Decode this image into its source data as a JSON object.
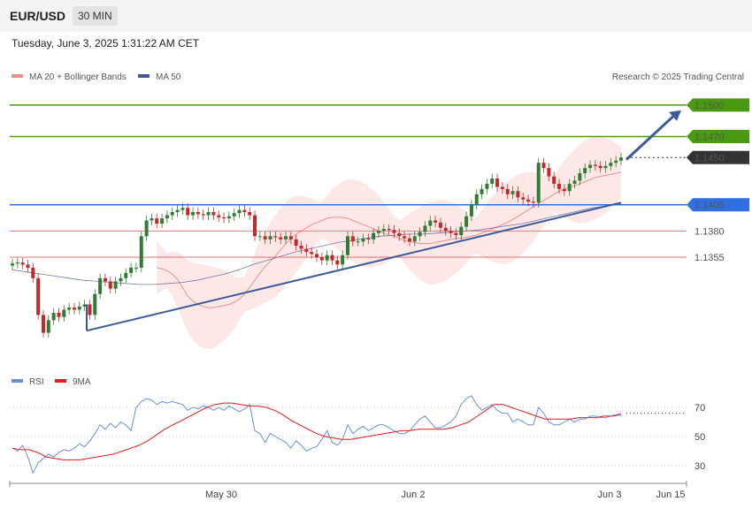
{
  "header": {
    "symbol": "EUR/USD",
    "interval": "30 MIN",
    "datetime": "Tuesday, June 3, 2025 1:31:22 AM CET"
  },
  "copyright": "Research © 2025 Trading Central",
  "colors": {
    "up": "#2e7d32",
    "down": "#c62828",
    "bb_fill": "#fde3e3",
    "ma20": "#ef8f8f",
    "ma50": "#4a5f9a",
    "trend": "#3a5a9a",
    "rsi": "#6a8fd8",
    "rsi_ma": "#e21b1b"
  },
  "chart_data": [
    {
      "type": "candlestick",
      "legend": [
        {
          "label": "MA 20 + Bollinger Bands",
          "color": "#f28b82"
        },
        {
          "label": "MA 50",
          "color": "#3a5a9a"
        }
      ],
      "x_ticks": [
        "May 30",
        "Jun 2",
        "Jun 3",
        "Jun 15"
      ],
      "y_range": [
        1.127,
        1.151
      ],
      "levels": [
        {
          "value": 1.15,
          "label": "1.1500",
          "color": "#4a9a0f",
          "style": "solid",
          "tag": true
        },
        {
          "value": 1.147,
          "label": "1.1470",
          "color": "#4a9a0f",
          "style": "solid",
          "tag": true
        },
        {
          "value": 1.145,
          "label": "1.1450",
          "color": "#333333",
          "style": "dotted",
          "tag": true
        },
        {
          "value": 1.1405,
          "label": "1.1405",
          "color": "#2f6fe0",
          "style": "solid",
          "tag": true
        },
        {
          "value": 1.138,
          "label": "1.1380",
          "color": "#e06060",
          "style": "solid",
          "tag": false
        },
        {
          "value": 1.1355,
          "label": "1.1355",
          "color": "#e06060",
          "style": "solid",
          "tag": false
        }
      ],
      "closes": [
        1.1349,
        1.135,
        1.1348,
        1.1345,
        1.1335,
        1.13,
        1.1283,
        1.1295,
        1.1302,
        1.1298,
        1.1305,
        1.1307,
        1.1305,
        1.1308,
        1.131,
        1.13,
        1.132,
        1.1335,
        1.1332,
        1.1325,
        1.1332,
        1.1335,
        1.134,
        1.1345,
        1.1345,
        1.1375,
        1.139,
        1.1392,
        1.1387,
        1.1392,
        1.1395,
        1.1398,
        1.14,
        1.1402,
        1.1395,
        1.1398,
        1.1396,
        1.1395,
        1.1398,
        1.1395,
        1.1393,
        1.1392,
        1.1394,
        1.1397,
        1.14,
        1.1398,
        1.1395,
        1.1375,
        1.1375,
        1.1372,
        1.1375,
        1.1374,
        1.1372,
        1.1375,
        1.1372,
        1.1366,
        1.1363,
        1.136,
        1.1358,
        1.1355,
        1.1352,
        1.1357,
        1.1352,
        1.1348,
        1.1357,
        1.1375,
        1.137,
        1.137,
        1.1373,
        1.1372,
        1.1378,
        1.138,
        1.1382,
        1.1381,
        1.1378,
        1.1375,
        1.1373,
        1.137,
        1.1375,
        1.1379,
        1.1385,
        1.139,
        1.1388,
        1.1383,
        1.138,
        1.1378,
        1.1376,
        1.1384,
        1.1394,
        1.1405,
        1.1415,
        1.142,
        1.1425,
        1.143,
        1.1422,
        1.142,
        1.1415,
        1.1418,
        1.1412,
        1.141,
        1.1408,
        1.1407,
        1.1445,
        1.144,
        1.1432,
        1.1425,
        1.142,
        1.1418,
        1.1425,
        1.1428,
        1.1435,
        1.144,
        1.1443,
        1.1442,
        1.144,
        1.1442,
        1.1445,
        1.1447,
        1.145
      ],
      "ma20": [
        1.1345,
        1.1344,
        1.1342,
        1.1339,
        1.1334,
        1.1326,
        1.1318,
        1.1313,
        1.131,
        1.1308,
        1.1307,
        1.1307,
        1.1308,
        1.1309,
        1.131,
        1.1312,
        1.1315,
        1.132,
        1.1326,
        1.1333,
        1.134,
        1.1346,
        1.1351,
        1.1356,
        1.1362,
        1.1368,
        1.1373,
        1.1377,
        1.138,
        1.1383,
        1.1386,
        1.1388,
        1.139,
        1.1392,
        1.1393,
        1.1393,
        1.1393,
        1.1392,
        1.139,
        1.1388,
        1.1386,
        1.1384,
        1.1382,
        1.138,
        1.1378,
        1.1376,
        1.1375,
        1.1373,
        1.1371,
        1.137,
        1.1369,
        1.1368,
        1.1368,
        1.1368,
        1.1369,
        1.137,
        1.1371,
        1.1372,
        1.1373,
        1.1373,
        1.1374,
        1.1375,
        1.1376,
        1.1378,
        1.138,
        1.1382,
        1.1384,
        1.1386,
        1.1388,
        1.1391,
        1.1394,
        1.1397,
        1.14,
        1.1403,
        1.1406,
        1.1409,
        1.1412,
        1.1415,
        1.1418,
        1.142,
        1.1422,
        1.1423,
        1.1425,
        1.1427,
        1.1429,
        1.1431,
        1.1432,
        1.1433,
        1.1434,
        1.1435,
        1.1436
      ],
      "ma50": [
        1.1343,
        1.1341,
        1.1339,
        1.1337,
        1.1335,
        1.1333,
        1.1332,
        1.1331,
        1.133,
        1.1329,
        1.1329,
        1.133,
        1.1331,
        1.1333,
        1.1336,
        1.1339,
        1.1343,
        1.1348,
        1.1352,
        1.1356,
        1.136,
        1.1363,
        1.1366,
        1.1369,
        1.1371,
        1.1373,
        1.1375,
        1.1376,
        1.1377,
        1.1377,
        1.1378,
        1.1379,
        1.138,
        1.1381,
        1.1383,
        1.1385,
        1.1387,
        1.139,
        1.1393,
        1.1396,
        1.1399,
        1.1402,
        1.1404,
        1.1406
      ],
      "trendlines": [
        {
          "x": [
            "May 29",
            "Jun 3"
          ],
          "y": [
            1.1285,
            1.1407
          ]
        },
        {
          "x": [
            "May 29",
            "Jun 3"
          ],
          "y": [
            1.1285,
            1.13
          ]
        }
      ],
      "arrow": {
        "from": 1.1448,
        "to": 1.1495
      }
    },
    {
      "type": "line",
      "legend": [
        {
          "label": "RSI",
          "color": "#6a8fd8"
        },
        {
          "label": "9MA",
          "color": "#e21b1b"
        }
      ],
      "y_ticks": [
        70,
        50,
        30
      ],
      "rsi": [
        42,
        40,
        44,
        36,
        25,
        32,
        35,
        38,
        36,
        39,
        41,
        40,
        42,
        45,
        43,
        47,
        52,
        58,
        55,
        59,
        56,
        60,
        58,
        54,
        70,
        74,
        76,
        75,
        72,
        74,
        73,
        74,
        73,
        72,
        68,
        70,
        69,
        71,
        70,
        68,
        70,
        68,
        71,
        69,
        67,
        69,
        72,
        54,
        52,
        46,
        52,
        50,
        48,
        46,
        42,
        47,
        44,
        40,
        42,
        43,
        48,
        54,
        46,
        44,
        48,
        58,
        52,
        55,
        57,
        54,
        56,
        58,
        58,
        56,
        54,
        52,
        52,
        54,
        58,
        62,
        64,
        60,
        56,
        56,
        58,
        60,
        64,
        72,
        76,
        78,
        72,
        68,
        70,
        72,
        68,
        66,
        66,
        60,
        62,
        60,
        58,
        58,
        70,
        66,
        60,
        58,
        58,
        60,
        62,
        60,
        62,
        62,
        64,
        64,
        63,
        63,
        64,
        65,
        66
      ],
      "rsi_ma": [
        42,
        41,
        41,
        39,
        36,
        35,
        34,
        34,
        34,
        35,
        36,
        37,
        38,
        40,
        42,
        44,
        47,
        51,
        55,
        58,
        61,
        64,
        67,
        70,
        72,
        73,
        73,
        72,
        71,
        71,
        70,
        68,
        65,
        61,
        58,
        55,
        52,
        50,
        49,
        48,
        48,
        49,
        50,
        51,
        52,
        53,
        54,
        54,
        55,
        55,
        55,
        55,
        56,
        58,
        60,
        64,
        68,
        72,
        72,
        70,
        68,
        66,
        64,
        62,
        62,
        62,
        62,
        63,
        63,
        63,
        64,
        64,
        65
      ]
    }
  ]
}
